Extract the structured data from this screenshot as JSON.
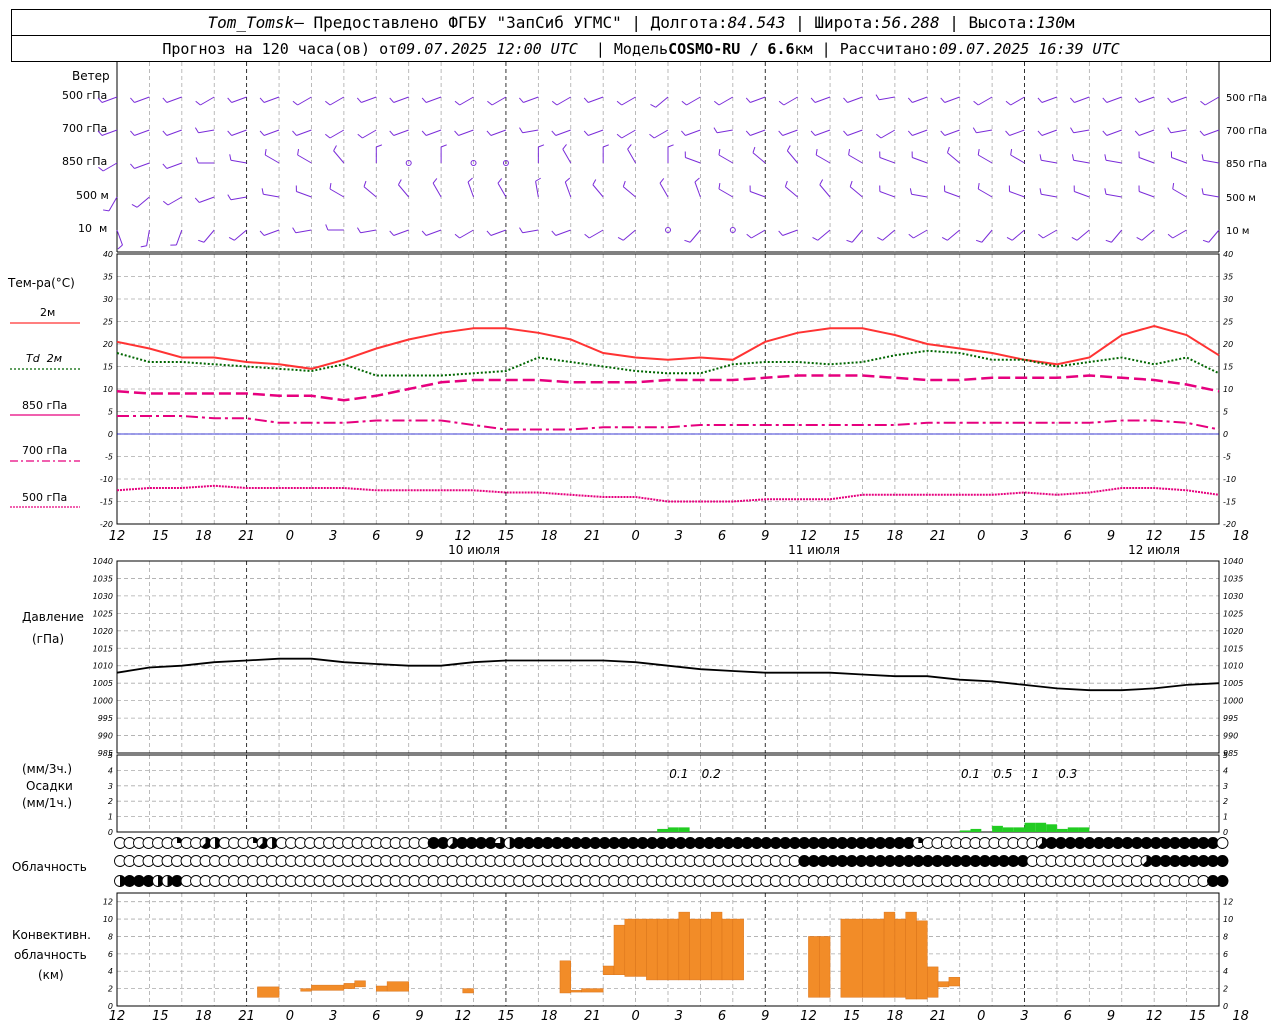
{
  "header": {
    "station": "Tom_Tomsk",
    "provider": "– Предоставлено ФГБУ \"ЗапСиб УГМС\"",
    "lon_label": "Долгота:",
    "lon": "84.543",
    "lat_label": "Широта:",
    "lat": "56.288",
    "alt_label": "Высота:",
    "alt": "130",
    "alt_unit": "м",
    "forecast_label": "Прогноз на 120 часа(ов) от",
    "forecast_from": "09.07.2025 12:00 UTC",
    "model_label": "Модель",
    "model": "COSMO-RU / 6.6",
    "model_unit": "км",
    "calc_label": "Рассчитано:",
    "calc_time": "09.07.2025 16:39 UTC"
  },
  "labels": {
    "wind": "Ветер",
    "wind_levels": [
      "500 гПа",
      "700 гПа",
      "850 гПа",
      "500 м",
      "10  м"
    ],
    "temp_title": "Тем-ра(°C)",
    "temp_legend": [
      "2м",
      "Td  2м",
      "850 гПа",
      "700 гПа",
      "500 гПа"
    ],
    "pressure_title": "Давление",
    "pressure_unit": "(гПа)",
    "precip_3h": "(мм/3ч.)",
    "precip_title": "Осадки",
    "precip_1h": "(мм/1ч.)",
    "cloud_title": "Облачность",
    "conv_title_1": "Конвективн.",
    "conv_title_2": "облачность",
    "conv_unit": "(км)"
  },
  "chart_data": {
    "time_axis": {
      "tick_labels": [
        "12",
        "15",
        "18",
        "21",
        "0",
        "3",
        "6",
        "9",
        "12",
        "15",
        "18",
        "21",
        "0",
        "3",
        "6",
        "9",
        "12",
        "15",
        "18",
        "21",
        "0",
        "3",
        "6",
        "9",
        "12",
        "15",
        "18"
      ],
      "day_labels": [
        "10 июля",
        "11 июля",
        "12 июля"
      ],
      "start_hour_utc": 12,
      "hours": 102
    },
    "temperature": {
      "type": "line",
      "ylim": [
        -20,
        40
      ],
      "ticks": [
        40,
        35,
        30,
        25,
        20,
        15,
        10,
        5,
        0,
        -5,
        -10,
        -15,
        -20
      ],
      "x_hours": [
        0,
        3,
        6,
        9,
        12,
        15,
        18,
        21,
        24,
        27,
        30,
        33,
        36,
        39,
        42,
        45,
        48,
        51,
        54,
        57,
        60,
        63,
        66,
        69,
        72,
        75,
        78,
        81,
        84,
        87,
        90,
        93,
        96,
        99,
        102
      ],
      "series": [
        {
          "name": "2м",
          "color": "#ff3333",
          "style": "solid",
          "values": [
            20.5,
            19,
            17,
            17,
            16,
            15.5,
            14.5,
            16.5,
            19,
            21,
            22.5,
            23.5,
            23.5,
            22.5,
            21,
            18,
            17,
            16.5,
            17,
            16.5,
            20.5,
            22.5,
            23.5,
            23.5,
            22,
            20,
            19,
            18,
            16.5,
            15.5,
            17,
            22,
            24,
            22,
            17.5
          ]
        },
        {
          "name": "Td  2м",
          "color": "#006600",
          "style": "dot",
          "values": [
            18,
            16,
            16,
            15.5,
            15,
            14.5,
            14,
            15.5,
            13,
            13,
            13,
            13.5,
            14,
            17,
            16,
            15,
            14,
            13.5,
            13.5,
            15.5,
            16,
            16,
            15.5,
            16,
            17.5,
            18.5,
            18,
            16.5,
            16.5,
            15,
            16,
            17,
            15.5,
            17,
            13.5
          ]
        },
        {
          "name": "850 гПа",
          "color": "#e6007e",
          "style": "dash",
          "values": [
            9.5,
            9,
            9,
            9,
            9,
            8.5,
            8.5,
            7.5,
            8.5,
            10,
            11.5,
            12,
            12,
            12,
            11.5,
            11.5,
            11.5,
            12,
            12,
            12,
            12.5,
            13,
            13,
            13,
            12.5,
            12,
            12,
            12.5,
            12.5,
            12.5,
            13,
            12.5,
            12,
            11,
            9.5
          ]
        },
        {
          "name": "700 гПа",
          "color": "#e6007e",
          "style": "dashdot",
          "values": [
            4,
            4,
            4,
            3.5,
            3.5,
            2.5,
            2.5,
            2.5,
            3,
            3,
            3,
            2,
            1,
            1,
            1,
            1.5,
            1.5,
            1.5,
            2,
            2,
            2,
            2,
            2,
            2,
            2,
            2.5,
            2.5,
            2.5,
            2.5,
            2.5,
            2.5,
            3,
            3,
            2.5,
            1
          ]
        },
        {
          "name": "500 гПа",
          "color": "#e6007e",
          "style": "dense",
          "values": [
            -12.5,
            -12,
            -12,
            -11.5,
            -12,
            -12,
            -12,
            -12,
            -12.5,
            -12.5,
            -12.5,
            -12.5,
            -13,
            -13,
            -13.5,
            -14,
            -14,
            -15,
            -15,
            -15,
            -14.5,
            -14.5,
            -14.5,
            -13.5,
            -13.5,
            -13.5,
            -13.5,
            -13.5,
            -13,
            -13.5,
            -13,
            -12,
            -12,
            -12.5,
            -13.5
          ]
        }
      ]
    },
    "pressure": {
      "type": "line",
      "ylim": [
        985,
        1040
      ],
      "ticks": [
        1040,
        1035,
        1030,
        1025,
        1020,
        1015,
        1010,
        1005,
        1000,
        995,
        990,
        985
      ],
      "x_hours": [
        0,
        3,
        6,
        9,
        12,
        15,
        18,
        21,
        24,
        27,
        30,
        33,
        36,
        39,
        42,
        45,
        48,
        51,
        54,
        57,
        60,
        63,
        66,
        69,
        72,
        75,
        78,
        81,
        84,
        87,
        90,
        93,
        96,
        99,
        102
      ],
      "values": [
        1008,
        1009.5,
        1010,
        1011,
        1011.5,
        1012,
        1012,
        1011,
        1010.5,
        1010,
        1010,
        1011,
        1011.5,
        1011.5,
        1011.5,
        1011.5,
        1011,
        1010,
        1009,
        1008.5,
        1008,
        1008,
        1008,
        1007.5,
        1007,
        1007,
        1006,
        1005.5,
        1004.5,
        1003.5,
        1003,
        1003,
        1003.5,
        1004.5,
        1005
      ]
    },
    "precipitation": {
      "type": "bar",
      "ylim": [
        0,
        5
      ],
      "ticks": [
        5,
        4,
        3,
        2,
        1,
        0
      ],
      "values_3h": [
        {
          "hour": 52,
          "label": "0.1"
        },
        {
          "hour": 55,
          "label": "0.2"
        },
        {
          "hour": 79,
          "label": "0.1"
        },
        {
          "hour": 82,
          "label": "0.5"
        },
        {
          "hour": 85,
          "label": "1"
        },
        {
          "hour": 88,
          "label": "0.3"
        }
      ],
      "values_1h": [
        {
          "hour": 51,
          "value": 0.2
        },
        {
          "hour": 52,
          "value": 0.3
        },
        {
          "hour": 53,
          "value": 0.3
        },
        {
          "hour": 79,
          "value": 0.1
        },
        {
          "hour": 80,
          "value": 0.2
        },
        {
          "hour": 82,
          "value": 0.4
        },
        {
          "hour": 83,
          "value": 0.3
        },
        {
          "hour": 84,
          "value": 0.3
        },
        {
          "hour": 85,
          "value": 0.6
        },
        {
          "hour": 86,
          "value": 0.6
        },
        {
          "hour": 87,
          "value": 0.5
        },
        {
          "hour": 88,
          "value": 0.2
        },
        {
          "hour": 89,
          "value": 0.3
        },
        {
          "hour": 90,
          "value": 0.3
        }
      ]
    },
    "cloudiness": {
      "rows": 3,
      "rows_eighths": [
        "000000200540002540000000000000000885888864888888888888888888888888888888888888888888200000000000058888888888888888880",
        "000000000000000000000000000000000000000000000000000000000000000000000000888888888888888888888888000000000000588888888",
        "488844800000000000000000000000000000000000000000000000000000000000000000000000000000000000000000000000000000000000088"
      ]
    },
    "convective_cloud": {
      "type": "bar",
      "ylim": [
        0,
        13
      ],
      "ticks": [
        12,
        10,
        8,
        6,
        4,
        2,
        0
      ],
      "bars": [
        {
          "h0": 13,
          "h1": 15,
          "base": 1.0,
          "top": 2.2
        },
        {
          "h0": 17,
          "h1": 18,
          "base": 1.7,
          "top": 2.0
        },
        {
          "h0": 18,
          "h1": 21,
          "base": 1.8,
          "top": 2.4
        },
        {
          "h0": 21,
          "h1": 22,
          "base": 2.0,
          "top": 2.6
        },
        {
          "h0": 22,
          "h1": 23,
          "base": 2.2,
          "top": 2.9
        },
        {
          "h0": 24,
          "h1": 26,
          "base": 1.7,
          "top": 2.3
        },
        {
          "h0": 25,
          "h1": 27,
          "base": 1.7,
          "top": 2.8
        },
        {
          "h0": 32,
          "h1": 33,
          "base": 1.5,
          "top": 2.0
        },
        {
          "h0": 41,
          "h1": 42,
          "base": 1.5,
          "top": 5.2
        },
        {
          "h0": 42,
          "h1": 43,
          "base": 1.6,
          "top": 1.8
        },
        {
          "h0": 43,
          "h1": 45,
          "base": 1.6,
          "top": 2.0
        },
        {
          "h0": 45,
          "h1": 46,
          "base": 3.6,
          "top": 4.6
        },
        {
          "h0": 46,
          "h1": 47,
          "base": 3.6,
          "top": 9.3
        },
        {
          "h0": 47,
          "h1": 48,
          "base": 3.4,
          "top": 10.0
        },
        {
          "h0": 48,
          "h1": 49,
          "base": 3.4,
          "top": 10.0
        },
        {
          "h0": 49,
          "h1": 50,
          "base": 3.0,
          "top": 10.0
        },
        {
          "h0": 50,
          "h1": 51,
          "base": 3.0,
          "top": 10.0
        },
        {
          "h0": 51,
          "h1": 52,
          "base": 3.0,
          "top": 10.0
        },
        {
          "h0": 52,
          "h1": 53,
          "base": 3.0,
          "top": 10.8
        },
        {
          "h0": 53,
          "h1": 54,
          "base": 3.0,
          "top": 10.0
        },
        {
          "h0": 54,
          "h1": 55,
          "base": 3.0,
          "top": 10.0
        },
        {
          "h0": 55,
          "h1": 56,
          "base": 3.0,
          "top": 10.8
        },
        {
          "h0": 56,
          "h1": 57,
          "base": 3.0,
          "top": 10.0
        },
        {
          "h0": 57,
          "h1": 58,
          "base": 3.0,
          "top": 10.0
        },
        {
          "h0": 64,
          "h1": 65,
          "base": 1.0,
          "top": 8.0
        },
        {
          "h0": 65,
          "h1": 66,
          "base": 1.0,
          "top": 8.0
        },
        {
          "h0": 67,
          "h1": 69,
          "base": 1.0,
          "top": 10.0
        },
        {
          "h0": 69,
          "h1": 71,
          "base": 1.0,
          "top": 10.0
        },
        {
          "h0": 71,
          "h1": 72,
          "base": 1.0,
          "top": 10.8
        },
        {
          "h0": 72,
          "h1": 73,
          "base": 1.0,
          "top": 10.0
        },
        {
          "h0": 73,
          "h1": 74,
          "base": 0.8,
          "top": 10.8
        },
        {
          "h0": 74,
          "h1": 75,
          "base": 0.8,
          "top": 9.8
        },
        {
          "h0": 75,
          "h1": 76,
          "base": 1.0,
          "top": 4.5
        },
        {
          "h0": 76,
          "h1": 77,
          "base": 2.2,
          "top": 2.8
        },
        {
          "h0": 77,
          "h1": 78,
          "base": 2.3,
          "top": 3.3
        }
      ]
    },
    "wind": {
      "levels": 5,
      "calm_hours": [
        [],
        [],
        [
          27,
          28,
          29,
          32,
          33,
          36
        ],
        [],
        [
          51,
          57,
          58
        ]
      ],
      "directions_deg": [
        [
          250,
          250,
          250,
          240,
          250,
          250,
          240,
          240,
          250,
          250,
          250,
          240,
          240,
          250,
          240,
          250,
          240,
          230,
          240,
          240,
          250,
          240,
          250,
          250,
          260,
          250,
          250,
          240,
          240,
          250,
          250,
          250,
          250,
          250,
          240
        ],
        [
          250,
          250,
          250,
          260,
          250,
          250,
          250,
          240,
          240,
          250,
          250,
          250,
          250,
          260,
          250,
          250,
          240,
          240,
          250,
          260,
          250,
          250,
          250,
          250,
          240,
          250,
          250,
          260,
          250,
          250,
          260,
          250,
          250,
          260,
          250
        ],
        [
          240,
          250,
          250,
          270,
          280,
          300,
          300,
          320,
          0,
          330,
          0,
          0,
          330,
          0,
          330,
          0,
          330,
          0,
          290,
          300,
          310,
          320,
          300,
          300,
          290,
          290,
          310,
          300,
          300,
          280,
          280,
          280,
          290,
          290,
          280
        ],
        [
          210,
          230,
          240,
          250,
          260,
          280,
          290,
          300,
          310,
          320,
          330,
          340,
          330,
          350,
          340,
          320,
          310,
          330,
          340,
          300,
          290,
          310,
          320,
          310,
          290,
          280,
          290,
          300,
          290,
          280,
          290,
          280,
          290,
          300,
          280
        ],
        [
          160,
          190,
          200,
          220,
          230,
          250,
          260,
          270,
          260,
          250,
          250,
          240,
          250,
          260,
          250,
          240,
          230,
          230,
          220,
          230,
          240,
          250,
          230,
          220,
          230,
          240,
          230,
          220,
          230,
          240,
          230,
          220,
          230,
          240,
          220
        ]
      ]
    }
  }
}
